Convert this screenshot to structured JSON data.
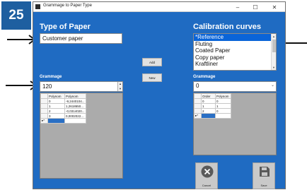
{
  "step": {
    "number": "25"
  },
  "window": {
    "title": "Grammage to Paper Type",
    "minimize": "–",
    "maximize": "☐",
    "close": "✕"
  },
  "colors": {
    "window_background": "#1f6bc2",
    "step_badge": "#1e5fa0",
    "selection": "#0a64d8"
  },
  "left": {
    "heading": "Type of Paper",
    "name_value": "Customer paper",
    "grammage_label": "Grammage",
    "grammage_value": "120",
    "grid": {
      "columns": [
        "Polynom",
        "Polynom"
      ],
      "rows": [
        [
          "0",
          "-9,2440104..."
        ],
        [
          "1",
          "1,2618650..."
        ],
        [
          "2",
          "-0,0314020..."
        ],
        [
          "3",
          "0,0002022..."
        ]
      ],
      "new_row_marker": "▸*"
    }
  },
  "middle": {
    "add_label": "Add",
    "new_label": "New"
  },
  "right": {
    "heading": "Calibration curves",
    "list_items": [
      "*Reference",
      "Fluting",
      "Coated Paper",
      "Copy paper",
      "Kraftliner"
    ],
    "selected_index": 0,
    "grammage_label": "Grammage",
    "grammage_value": "0",
    "grid": {
      "columns": [
        "Order",
        "Polynom"
      ],
      "rows": [
        [
          "0",
          "0"
        ],
        [
          "1",
          "1"
        ],
        [
          "2",
          "0"
        ]
      ],
      "new_row_marker": "▸*"
    },
    "cancel_label": "Cancel",
    "save_label": "Save"
  },
  "icons": {
    "cancel": "x-circle-icon",
    "save": "floppy-disk-icon",
    "arrows": "pointer-arrow-icon"
  }
}
